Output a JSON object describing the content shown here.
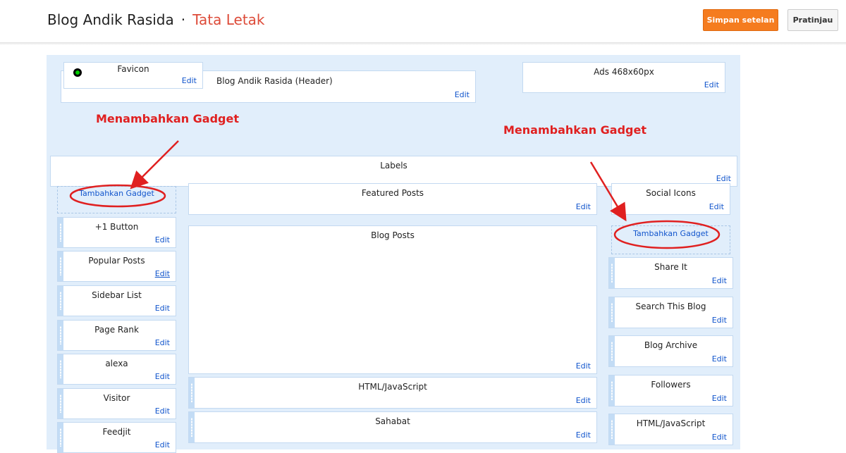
{
  "header": {
    "blog_name": "Blog Andik Rasida",
    "separator": "·",
    "page_name": "Tata Letak",
    "save_label": "Simpan setelan",
    "preview_label": "Pratinjau"
  },
  "edit_label": "Edit",
  "top": {
    "favicon": "Favicon",
    "header_gadget": "Blog Andik Rasida (Header)",
    "ads": "Ads 468x60px",
    "labels": "Labels"
  },
  "left_sidebar": {
    "add_gadget": "Tambahkan Gadget",
    "items": [
      "+1 Button",
      "Popular Posts",
      "Sidebar List",
      "Page Rank",
      "alexa",
      "Visitor",
      "Feedjit"
    ]
  },
  "main": {
    "featured": "Featured Posts",
    "blog_posts": "Blog Posts",
    "items": [
      "HTML/JavaScript",
      "Sahabat"
    ]
  },
  "right_sidebar": {
    "social": "Social Icons",
    "add_gadget": "Tambahkan Gadget",
    "items": [
      "Share It",
      "Search This Blog",
      "Blog Archive",
      "Followers",
      "HTML/JavaScript"
    ]
  },
  "annotations": {
    "left": "Menambahkan Gadget",
    "right": "Menambahkan Gadget"
  },
  "colors": {
    "accent": "#dd4b39",
    "save_button": "#f57c1f",
    "canvas": "#e1eefb",
    "annotation": "#e02020",
    "link": "#1155cc"
  }
}
